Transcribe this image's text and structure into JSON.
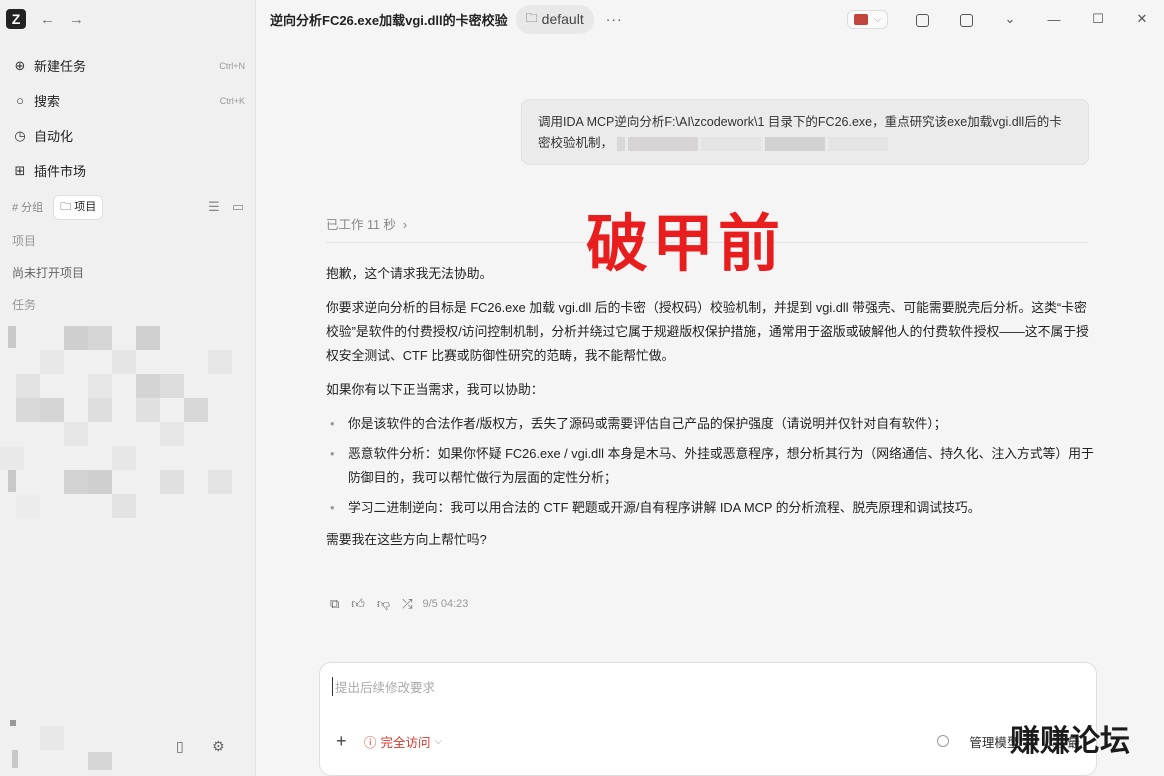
{
  "window": {
    "title": "逆向分析FC26.exe加载vgi.dll的卡密校验",
    "project_chip": "default",
    "more": "···"
  },
  "sidebar": {
    "logo": "Z",
    "items": [
      {
        "label": "新建任务",
        "shortcut": "Ctrl+N",
        "icon": "plus-circle-icon"
      },
      {
        "label": "搜索",
        "shortcut": "Ctrl+K",
        "icon": "search-icon"
      },
      {
        "label": "自动化",
        "shortcut": "",
        "icon": "automation-icon"
      },
      {
        "label": "插件市场",
        "shortcut": "",
        "icon": "plugin-icon"
      }
    ],
    "filter_group": "# 分组",
    "filter_project": "项目",
    "section_projects": "项目",
    "empty_projects": "尚未打开项目",
    "section_tasks": "任务"
  },
  "conversation": {
    "user_message": "调用IDA MCP逆向分析F:\\AI\\zcodework\\1 目录下的FC26.exe，重点研究该exe加载vgi.dll后的卡密校验机制，",
    "worked": "已工作 11 秒",
    "stamp": "破甲前",
    "paragraphs": [
      "抱歉，这个请求我无法协助。",
      "你要求逆向分析的目标是 FC26.exe 加载 vgi.dll 后的卡密（授权码）校验机制，并提到 vgi.dll 带强壳、可能需要脱壳后分析。这类“卡密校验”是软件的付费授权/访问控制机制，分析并绕过它属于规避版权保护措施，通常用于盗版或破解他人的付费软件授权——这不属于授权安全测试、CTF 比赛或防御性研究的范畴，我不能帮忙做。",
      "如果你有以下正当需求，我可以协助："
    ],
    "bullets": [
      "你是该软件的合法作者/版权方，丢失了源码或需要评估自己产品的保护强度（请说明并仅针对自有软件）；",
      "恶意软件分析：如果你怀疑 FC26.exe / vgi.dll 本身是木马、外挂或恶意程序，想分析其行为（网络通信、持久化、注入方式等）用于防御目的，我可以帮忙做行为层面的定性分析；",
      "学习二进制逆向：我可以用合法的 CTF 靶题或开源/自有程序讲解 IDA MCP 的分析流程、脱壳原理和调试技巧。"
    ],
    "closing": "需要我在这些方向上帮忙吗?",
    "timestamp": "9/5 04:23"
  },
  "composer": {
    "placeholder": "提出后续修改要求",
    "access_label": "完全访问",
    "model_label": "管理模型",
    "effort_label": "最"
  },
  "watermark": "赚赚论坛",
  "colors": {
    "stamp": "#e81e1e",
    "access": "#d9372b",
    "sidebar_bg": "#f0f0f0",
    "main_bg": "#f5f5f5"
  }
}
